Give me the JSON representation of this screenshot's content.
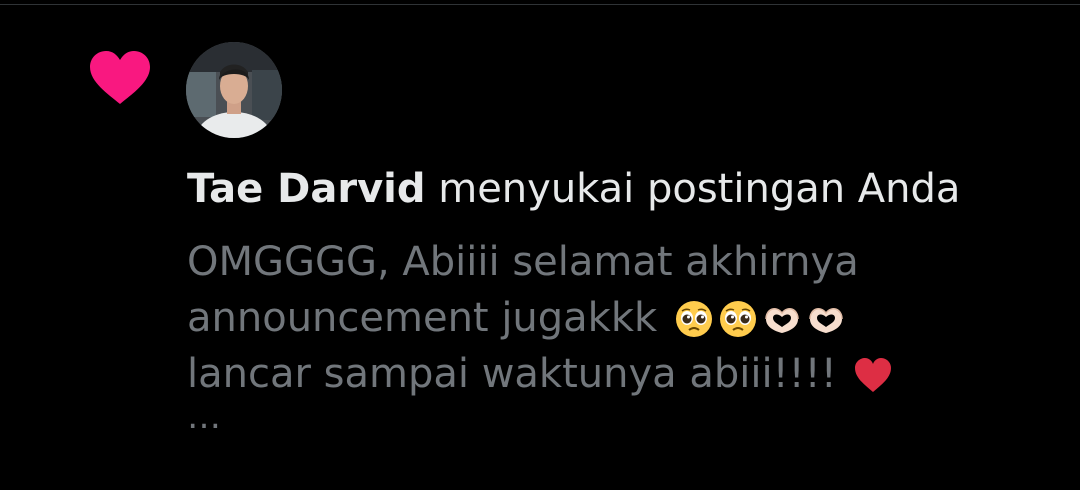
{
  "notification": {
    "type_icon": "heart-icon",
    "accent_color": "#f91880",
    "actor": {
      "name": "Tae Darvid",
      "avatar_icon": "avatar"
    },
    "action_text": " menyukai postingan Anda",
    "post_preview": {
      "lines": [
        "OMGGGG, Abiiii selamat akhirnya",
        "announcement jugakkk",
        "lancar sampai waktunya abiii!!!!"
      ],
      "emojis": [
        "pleading-face-emoji",
        "pleading-face-emoji",
        "heart-hands-emoji",
        "heart-hands-emoji",
        "red-heart-emoji"
      ],
      "truncation": "…"
    }
  },
  "colors": {
    "background": "#000000",
    "primary_text": "#e7e9ea",
    "secondary_text": "#71767b"
  }
}
